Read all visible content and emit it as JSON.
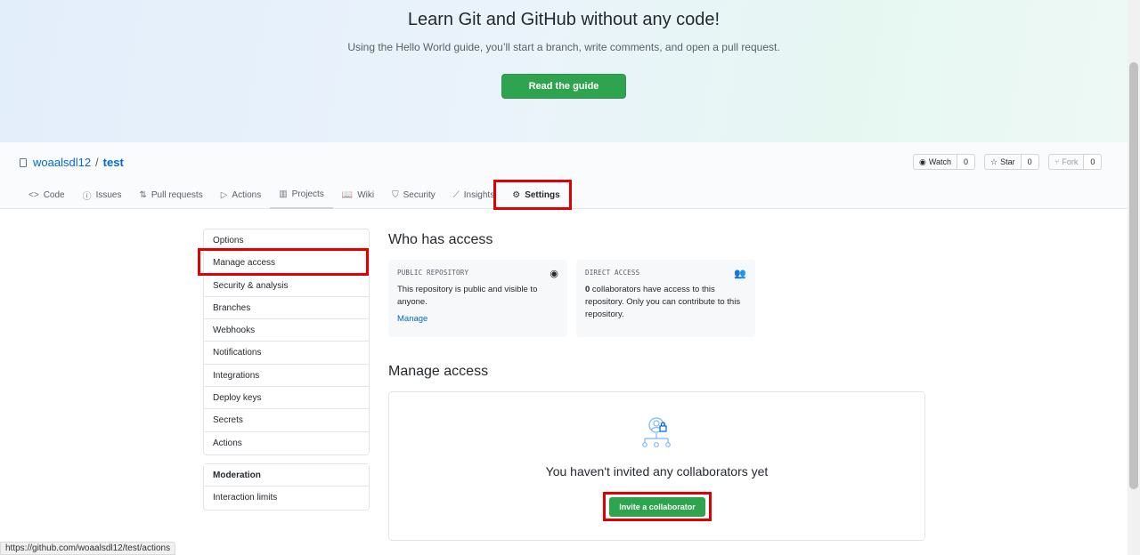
{
  "hero": {
    "title": "Learn Git and GitHub without any code!",
    "subtitle": "Using the Hello World guide, you’ll start a branch, write comments, and open a pull request.",
    "button": "Read the guide"
  },
  "repo": {
    "owner": "woaalsdl12",
    "separator": "/",
    "name": "test",
    "watch": {
      "label": "Watch",
      "count": "0"
    },
    "star": {
      "label": "Star",
      "count": "0"
    },
    "fork": {
      "label": "Fork",
      "count": "0"
    }
  },
  "tabs": [
    {
      "label": "Code",
      "icon": "<>"
    },
    {
      "label": "Issues",
      "icon": "ⓘ"
    },
    {
      "label": "Pull requests",
      "icon": "⇅"
    },
    {
      "label": "Actions",
      "icon": "▷"
    },
    {
      "label": "Projects",
      "icon": "▥"
    },
    {
      "label": "Wiki",
      "icon": "📖"
    },
    {
      "label": "Security",
      "icon": "⛉"
    },
    {
      "label": "Insights",
      "icon": "⟋"
    },
    {
      "label": "Settings",
      "icon": "⚙"
    }
  ],
  "sidebar": {
    "items": [
      "Options",
      "Manage access",
      "Security & analysis",
      "Branches",
      "Webhooks",
      "Notifications",
      "Integrations",
      "Deploy keys",
      "Secrets",
      "Actions"
    ],
    "moderation_header": "Moderation",
    "moderation_items": [
      "Interaction limits"
    ]
  },
  "who_has_access": {
    "title": "Who has access",
    "public_card": {
      "label": "PUBLIC REPOSITORY",
      "text": "This repository is public and visible to anyone.",
      "link": "Manage"
    },
    "direct_card": {
      "label": "DIRECT ACCESS",
      "count": "0",
      "text": " collaborators have access to this repository. Only you can contribute to this repository."
    }
  },
  "manage_access": {
    "title": "Manage access",
    "empty_message": "You haven't invited any collaborators yet",
    "invite_button": "Invite a collaborator"
  },
  "status_bar": "https://github.com/woaalsdl12/test/actions",
  "colors": {
    "green": "#2ea44f",
    "link": "#0366d6",
    "highlight": "#e00000"
  }
}
